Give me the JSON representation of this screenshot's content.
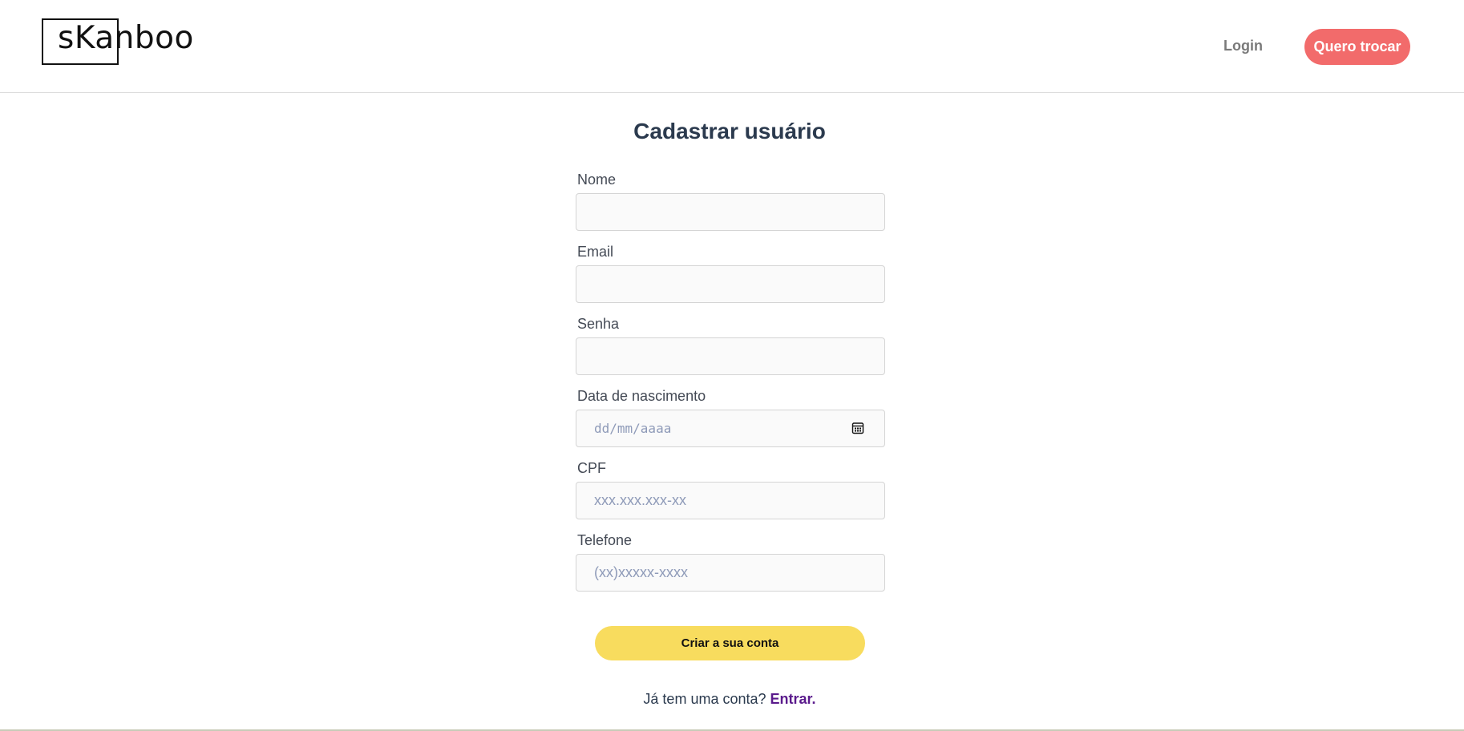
{
  "header": {
    "logo_text": "sKanboo",
    "login_label": "Login",
    "cta_label": "Quero trocar"
  },
  "form": {
    "title": "Cadastrar usuário",
    "fields": [
      {
        "label": "Nome",
        "placeholder": "",
        "value": ""
      },
      {
        "label": "Email",
        "placeholder": "",
        "value": ""
      },
      {
        "label": "Senha",
        "placeholder": "",
        "value": ""
      },
      {
        "label": "Data de nascimento",
        "placeholder": "dd/mm/aaaa",
        "value": ""
      },
      {
        "label": "CPF",
        "placeholder": "xxx.xxx.xxx-xx",
        "value": ""
      },
      {
        "label": "Telefone",
        "placeholder": "(xx)xxxxx-xxxx",
        "value": ""
      }
    ],
    "submit_label": "Criar a sua conta",
    "login_prompt": "Já tem uma conta?",
    "login_link": "Entrar."
  },
  "colors": {
    "cta": "#f26b6b",
    "submit": "#f8dc5e",
    "title": "#2b3a4e",
    "link": "#5a1a8c"
  },
  "icons": {
    "date_field": "calendar-icon"
  }
}
